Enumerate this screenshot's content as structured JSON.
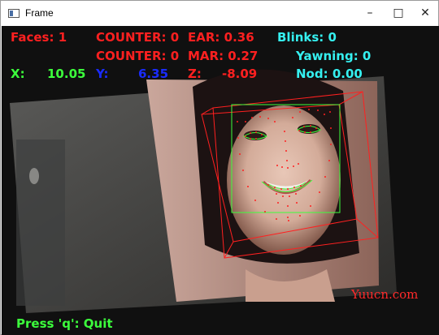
{
  "window": {
    "title": "Frame",
    "minimize_glyph": "–",
    "maximize_glyph": "□",
    "close_glyph": "✕"
  },
  "overlay": {
    "faces": "Faces: 1",
    "counter1": "COUNTER: 0",
    "ear": "EAR: 0.36",
    "blinks": "Blinks: 0",
    "counter2": "COUNTER: 0",
    "mar": "MAR: 0.27",
    "yawning": "Yawning: 0",
    "x_label": "X:",
    "x_value": "10.05",
    "y_label": "Y:",
    "y_value": "6.35",
    "z_label": "Z:",
    "z_value": "-8.09",
    "nod": "Nod: 0.00",
    "quit_hint": "Press 'q': Quit"
  },
  "watermark": "Yuucn.com",
  "colors": {
    "red": "#ff2020",
    "cyan": "#35f0f0",
    "green": "#3cff3c",
    "blue": "#1a2cff",
    "frame_bg": "#000000"
  },
  "icons": [
    "app-frame-icon",
    "minimize-icon",
    "maximize-icon",
    "close-icon"
  ]
}
